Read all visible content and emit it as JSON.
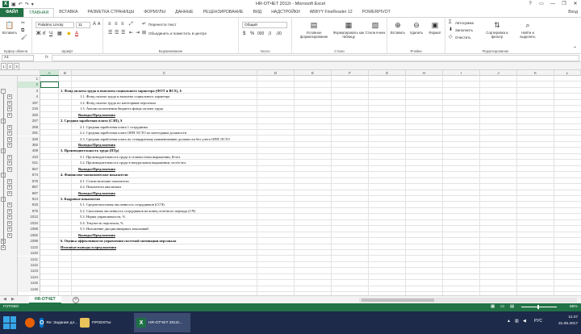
{
  "window": {
    "title": "HR-ОТЧЕТ 2012г - Microsoft Excel",
    "help": "?",
    "min": "—",
    "max": "❐",
    "close": "✕"
  },
  "ribbon_tabs": [
    "ФАЙЛ",
    "ГЛАВНАЯ",
    "ВСТАВКА",
    "РАЗМЕТКА СТРАНИЦЫ",
    "ФОРМУЛЫ",
    "ДАННЫЕ",
    "РЕЦЕНЗИРОВАНИЕ",
    "ВИД",
    "НАДСТРОЙКИ",
    "ABBYY FineReader 12",
    "POWERPIVOT"
  ],
  "login": "Вход",
  "ribbon": {
    "paste": "Вставить",
    "clipboard": "Буфер обмена",
    "font_name": "Palatino Linoty",
    "font_size": "11",
    "font": "Шрифт",
    "wrap_text": "Перенести текст",
    "merge_center": "Объединить и поместить в центре",
    "alignment": "Выравнивание",
    "number_format": "Общий",
    "number": "Число",
    "cond_format": "Условное форматирование",
    "format_table": "Форматировать как таблицу",
    "cell_styles": "Стили ячеек",
    "styles": "Стили",
    "insert": "Вставить",
    "delete": "Удалить",
    "format": "Формат",
    "cells": "Ячейки",
    "autosum": "Автосумма",
    "fill": "Заполнить",
    "clear": "Очистить",
    "sort_filter": "Сортировка и фильтр",
    "find_select": "Найти и выделить",
    "editing": "Редактирование"
  },
  "namebox": "A1",
  "fx": "fx",
  "outline_levels": [
    "1",
    "2",
    "3"
  ],
  "columns": [
    "A",
    "B",
    "C",
    "D",
    "E",
    "F",
    "G",
    "H",
    "I",
    "J",
    "K",
    "L",
    "M",
    "N",
    "O",
    "P",
    "Q",
    "R",
    "S"
  ],
  "rows": [
    {
      "n": "1",
      "a": "",
      "b": ""
    },
    {
      "n": "2",
      "a": "",
      "b": ""
    },
    {
      "n": "3",
      "a": "",
      "b": "1. Фонд оплаты труда и выплаты социального характера (ФОТ и ВСХ), $"
    },
    {
      "n": "4",
      "a": "",
      "b": "1.1. Фонд оплаты труда и выплаты социального характера"
    },
    {
      "n": "157",
      "a": "",
      "b": "1.2. Фонд оплаты труда по категориям персонала"
    },
    {
      "n": "215",
      "a": "",
      "b": "1.3. Анализ исполнения бюджета фонда оплаты труда"
    },
    {
      "n": "250",
      "a": "",
      "b": "Выводы/Предложения"
    },
    {
      "n": "267",
      "a": "",
      "b": "2. Средняя заработная плата (СЗП), $"
    },
    {
      "n": "268",
      "a": "",
      "b": "2.1. Средняя заработная плата 1 сотрудника"
    },
    {
      "n": "291",
      "a": "",
      "b": "2.2. Средняя заработная плата ОПП ЛСТО по категориям должности"
    },
    {
      "n": "326",
      "a": "",
      "b": "2.3. Средняя заработная плата по стандартному наименованию должности без учета ОПП ЛСТО"
    },
    {
      "n": "392",
      "a": "",
      "b": "Выводы/Предложения"
    },
    {
      "n": "409",
      "a": "",
      "b": "3. Производительность труда (ПТр)"
    },
    {
      "n": "410",
      "a": "",
      "b": "3.1. Производительность труда в стоимостном выражении, $/чел."
    },
    {
      "n": "511",
      "a": "",
      "b": "3.2. Производительность труда в натуральном выражении, чел/ч/чел."
    },
    {
      "n": "557",
      "a": "",
      "b": "Выводы/Предложения"
    },
    {
      "n": "574",
      "a": "",
      "b": "4. Финансово-экономические показатели"
    },
    {
      "n": "575",
      "a": "",
      "b": "4.1. Статистические показатели"
    },
    {
      "n": "857",
      "a": "",
      "b": "4.2. Показатели аналитики"
    },
    {
      "n": "897",
      "a": "",
      "b": "Выводы/Предложения"
    },
    {
      "n": "914",
      "a": "",
      "b": "5. Кадровые показатели"
    },
    {
      "n": "915",
      "a": "",
      "b": "5.1. Среднесписочная численность сотрудников (ССЧ)"
    },
    {
      "n": "975",
      "a": "",
      "b": "5.2. Списочная численность сотрудников на конец отчетного периода (СЧ)"
    },
    {
      "n": "1012",
      "a": "",
      "b": "5.3. Норма управляемости, %"
    },
    {
      "n": "1034",
      "a": "",
      "b": "5.4. Текучесть персонала, %"
    },
    {
      "n": "1058",
      "a": "",
      "b": "5.5. Наложение дисциплинарных взысканий"
    },
    {
      "n": "1082",
      "a": "",
      "b": "Выводы/Предложения"
    },
    {
      "n": "1099",
      "a": "",
      "b": "6. Оценка эффективности управления системой мотивации персонала"
    },
    {
      "n": "1122",
      "a": "",
      "b": "Итоговые выводы и предложения"
    },
    {
      "n": "1140",
      "a": "",
      "b": ""
    },
    {
      "n": "1141",
      "a": "",
      "b": ""
    },
    {
      "n": "1142",
      "a": "",
      "b": ""
    },
    {
      "n": "1143",
      "a": "",
      "b": ""
    },
    {
      "n": "1144",
      "a": "",
      "b": ""
    },
    {
      "n": "1145",
      "a": "",
      "b": ""
    },
    {
      "n": "1146",
      "a": "",
      "b": ""
    }
  ],
  "sheet_tab": "HR-ОТЧЕТ",
  "add_sheet": "+",
  "status": {
    "ready": "ГОТОВО",
    "zoom": "65%"
  },
  "taskbar": {
    "items": [
      {
        "label": "Re: Задание дл..."
      },
      {
        "label": "ПРОЕКТЫ"
      },
      {
        "label": "HR-ОТЧЕТ 2012г..."
      }
    ],
    "lang": "РУС",
    "time": "11:47",
    "date": "31.05.2017"
  }
}
